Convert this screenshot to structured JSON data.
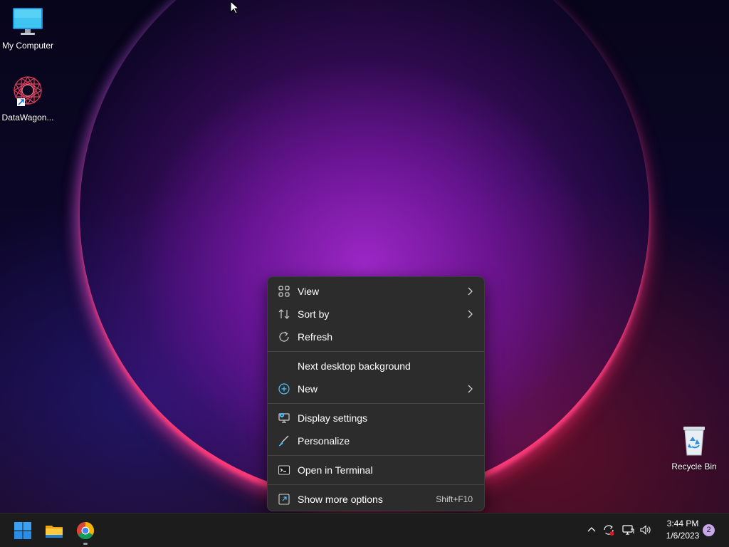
{
  "desktop": {
    "icons": [
      {
        "label": "My Computer",
        "icon": "monitor-icon"
      },
      {
        "label": "DataWagon...",
        "icon": "datawagon-icon"
      },
      {
        "label": "Recycle Bin",
        "icon": "recycle-bin-icon"
      }
    ]
  },
  "context_menu": {
    "items": [
      {
        "label": "View",
        "icon": "grid-icon",
        "submenu": true
      },
      {
        "label": "Sort by",
        "icon": "sort-icon",
        "submenu": true
      },
      {
        "label": "Refresh",
        "icon": "refresh-icon"
      },
      {
        "label": "Next desktop background"
      },
      {
        "label": "New",
        "icon": "plus-circle-icon",
        "submenu": true
      },
      {
        "label": "Display settings",
        "icon": "display-settings-icon"
      },
      {
        "label": "Personalize",
        "icon": "brush-icon"
      },
      {
        "label": "Open in Terminal",
        "icon": "terminal-icon"
      },
      {
        "label": "Show more options",
        "icon": "expand-icon",
        "shortcut": "Shift+F10"
      }
    ]
  },
  "taskbar": {
    "pinned": [
      "start-icon",
      "file-explorer-icon",
      "chrome-icon"
    ],
    "clock": {
      "time": "3:44 PM",
      "date": "1/6/2023"
    },
    "notification_count": "2"
  },
  "colors": {
    "menu_bg": "#2c2c2c",
    "taskbar_bg": "#1c1c1c",
    "accent_blue": "#4cc2ff",
    "glow_pink": "#ff3c78"
  }
}
